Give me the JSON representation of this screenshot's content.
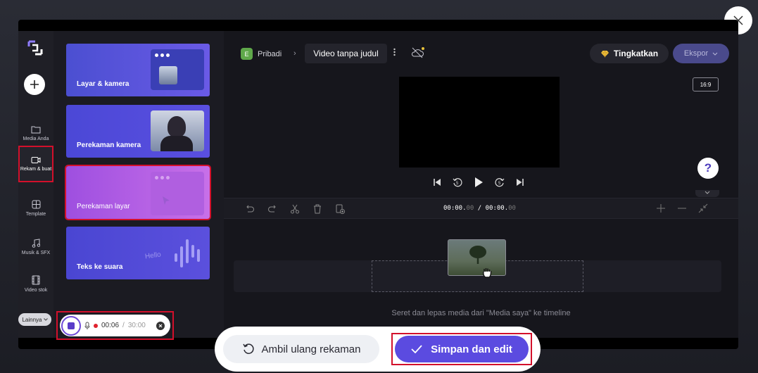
{
  "rail": {
    "items": [
      {
        "label": "Media Anda"
      },
      {
        "label": "Rekam & buat"
      },
      {
        "label": "Template"
      },
      {
        "label": "Musik & SFX"
      },
      {
        "label": "Video stok"
      }
    ],
    "more_label": "Lainnya"
  },
  "panel": {
    "cards": [
      {
        "label": "Layar & kamera"
      },
      {
        "label": "Perekaman kamera"
      },
      {
        "label": "Perekaman layar"
      },
      {
        "label": "Teks ke suara"
      }
    ],
    "hello_text": "Hello"
  },
  "recording": {
    "elapsed": "00:06",
    "separator": "/",
    "limit": "30:00"
  },
  "header": {
    "workspace_initial": "E",
    "workspace_name": "Pribadi",
    "crumb_separator": "›",
    "project_title": "Video tanpa judul",
    "upgrade_label": "Tingkatkan",
    "export_label": "Ekspor"
  },
  "preview": {
    "aspect_ratio": "16:9",
    "help_label": "?"
  },
  "timeline": {
    "time_current_main": "00:00.",
    "time_current_frac": "00",
    "time_sep": " / ",
    "time_total_main": "00:00.",
    "time_total_frac": "00",
    "drop_hint": "Seret dan lepas media dari \"Media saya\" ke timeline"
  },
  "actions": {
    "retake_label": "Ambil ulang rekaman",
    "save_label": "Simpan dan edit"
  },
  "colors": {
    "accent": "#5b4be0",
    "highlight": "#d3102b"
  }
}
